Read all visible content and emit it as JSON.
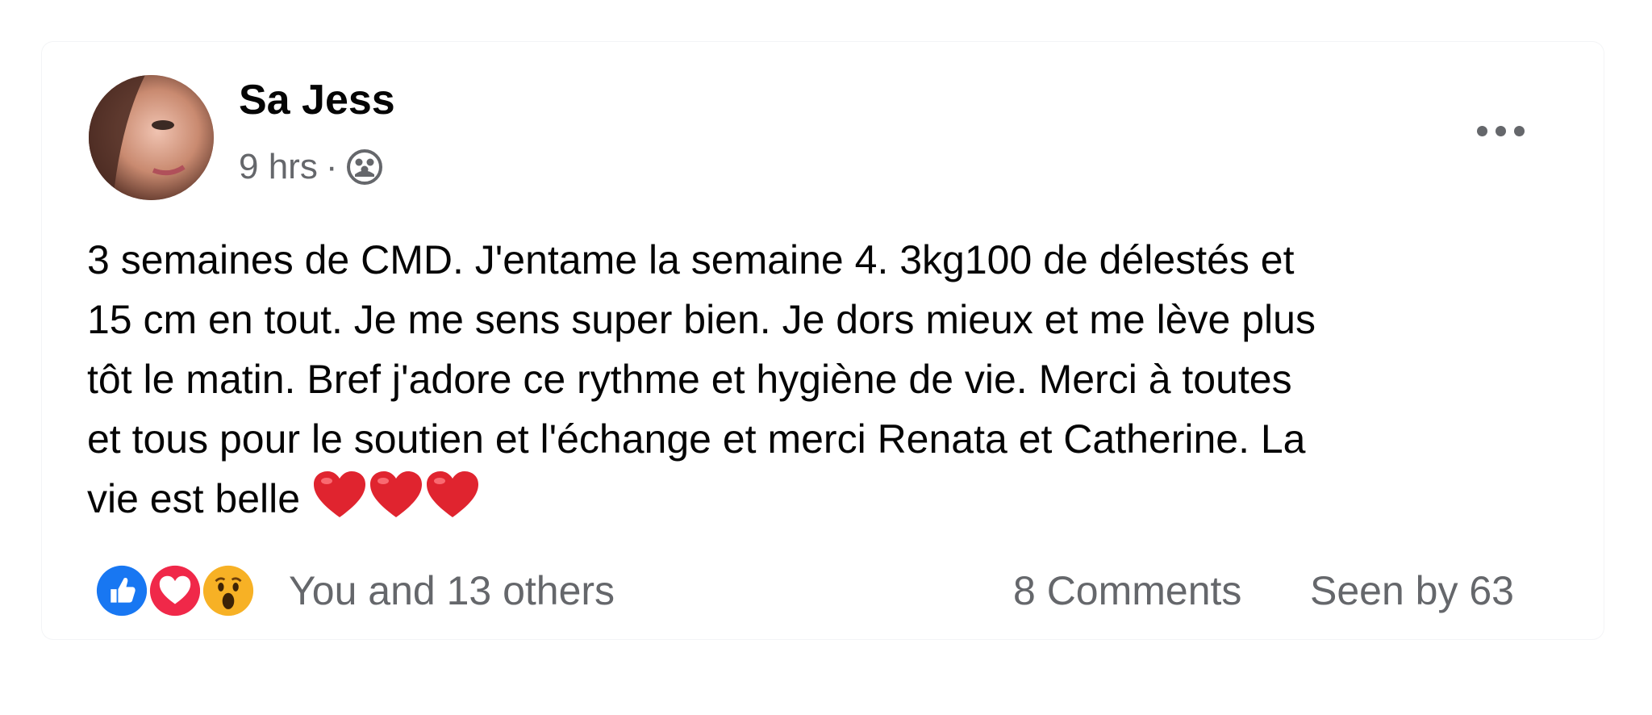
{
  "post": {
    "author": "Sa Jess",
    "time": "9 hrs",
    "separator": "·",
    "audience_icon": "group-icon",
    "more_icon": "more-options-icon",
    "text": "3 semaines de CMD. J'entame la semaine 4. 3kg100 de délestés et\n15 cm en tout. Je me sens super bien. Je dors mieux et me lève plus\ntôt le matin. Bref j'adore ce rythme et hygiène de vie. Merci à toutes\net tous pour le soutien et l'échange et merci Renata et Catherine. La\nvie est belle ",
    "emoji_icons": [
      "heart-emoji",
      "heart-emoji",
      "heart-emoji"
    ]
  },
  "footer": {
    "reaction_icons": [
      "like-icon",
      "love-icon",
      "wow-icon"
    ],
    "reactions_text": "You and 13 others",
    "comments_text": "8 Comments",
    "seen_text": "Seen by 63"
  },
  "colors": {
    "text_primary": "#050505",
    "text_secondary": "#65676b",
    "like_blue": "#1877f2",
    "love_red": "#f02849",
    "wow_yellow": "#f7b125"
  }
}
